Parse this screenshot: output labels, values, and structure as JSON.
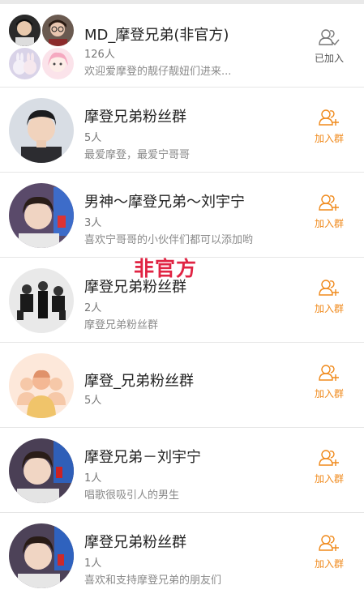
{
  "colors": {
    "accent": "#f08a1c",
    "watermark": "#e02443",
    "divider": "#e6e6e6"
  },
  "watermark_text": "非官方",
  "groups": [
    {
      "name": "MD_摩登兄弟(非官方)",
      "count": "126人",
      "desc": "欢迎爱摩登的靓仔靓妞们进来...",
      "action": "已加入",
      "action_icon": "group-joined-icon",
      "joined": true
    },
    {
      "name": "摩登兄弟粉丝群",
      "count": "5人",
      "desc": "最爱摩登，最爱宁哥哥",
      "action": "加入群",
      "action_icon": "group-add-icon",
      "joined": false
    },
    {
      "name": "男神～摩登兄弟～刘宇宁",
      "count": "3人",
      "desc": "喜欢宁哥哥的小伙伴们都可以添加哟",
      "action": "加入群",
      "action_icon": "group-add-icon",
      "joined": false
    },
    {
      "name": "摩登兄弟粉丝群",
      "count": "2人",
      "desc": "摩登兄弟粉丝群",
      "action": "加入群",
      "action_icon": "group-add-icon",
      "joined": false
    },
    {
      "name": "摩登_兄弟粉丝群",
      "count": "5人",
      "desc": "",
      "action": "加入群",
      "action_icon": "group-add-icon",
      "joined": false
    },
    {
      "name": "摩登兄弟－刘宇宁",
      "count": "1人",
      "desc": "唱歌很吸引人的男生",
      "action": "加入群",
      "action_icon": "group-add-icon",
      "joined": false
    },
    {
      "name": "摩登兄弟粉丝群",
      "count": "1人",
      "desc": "喜欢和支持摩登兄弟的朋友们",
      "action": "加入群",
      "action_icon": "group-add-icon",
      "joined": false
    }
  ]
}
